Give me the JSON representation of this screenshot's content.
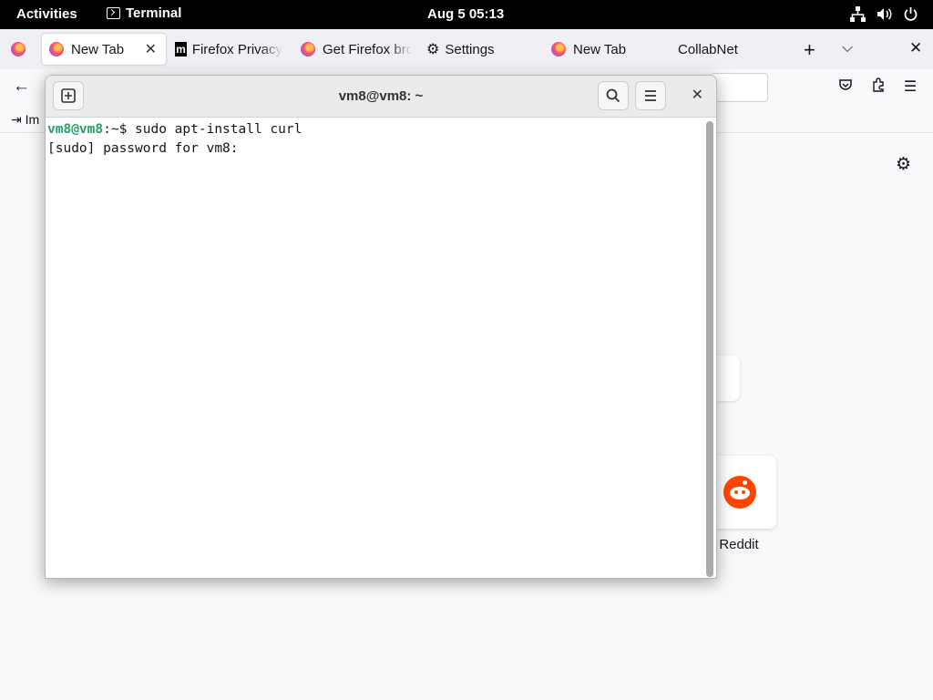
{
  "topbar": {
    "activities": "Activities",
    "app_name": "Terminal",
    "clock": "Aug 5  05:13"
  },
  "browser": {
    "tabs": [
      {
        "label": "New Tab",
        "icon": "firefox-icon",
        "active": true
      },
      {
        "label": "Firefox Privacy",
        "icon": "mozilla-icon"
      },
      {
        "label": "Get Firefox bro",
        "icon": "firefox-icon"
      },
      {
        "label": "Settings",
        "icon": "gear-icon"
      },
      {
        "label": "New Tab",
        "icon": "firefox-icon"
      },
      {
        "label": "CollabNet",
        "icon": "none"
      }
    ],
    "bookmarks_visible": "Im",
    "shortcut_tile": {
      "label": "Reddit",
      "brand_color": "#ff4500"
    }
  },
  "terminal": {
    "title": "vm8@vm8: ~",
    "prompt_user": "vm8@vm8",
    "prompt_path": ":~$ ",
    "command": "sudo apt-install curl",
    "line2": "[sudo] password for vm8:",
    "prompt_color": "#26a269"
  }
}
